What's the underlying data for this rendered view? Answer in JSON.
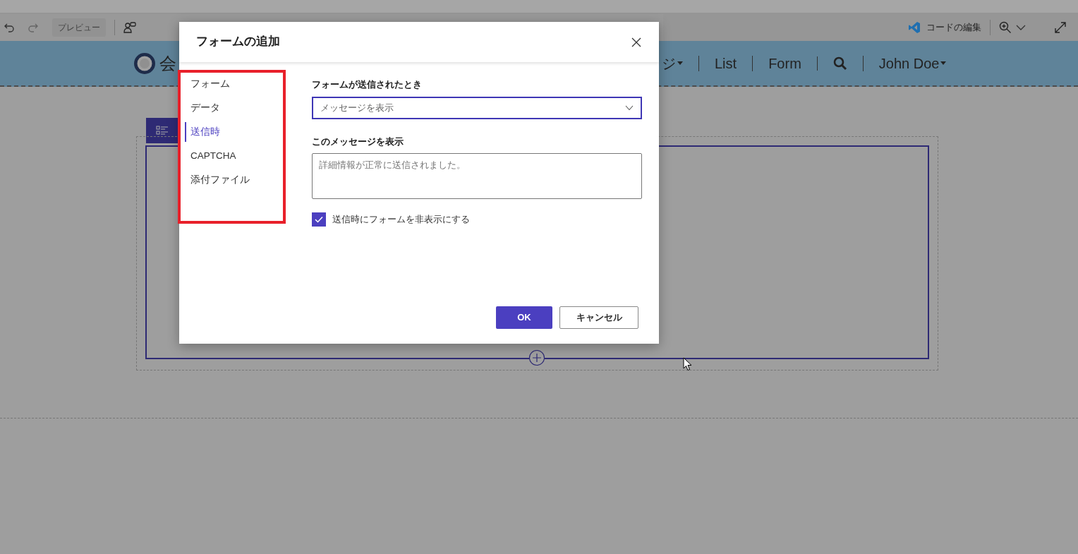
{
  "toolbar": {
    "preview_button": "プレビュー",
    "edit_code_button": "コードの編集"
  },
  "header": {
    "brand": "会",
    "nav_items": [
      {
        "kind": "link",
        "label": "ジ",
        "dropdown": true
      },
      {
        "kind": "link",
        "label": "List",
        "dropdown": false
      },
      {
        "kind": "link",
        "label": "Form",
        "dropdown": false
      },
      {
        "kind": "search"
      },
      {
        "kind": "link",
        "label": "John Doe",
        "dropdown": true
      }
    ]
  },
  "dialog": {
    "title": "フォームの追加",
    "sidebar": [
      {
        "label": "フォーム",
        "selected": false
      },
      {
        "label": "データ",
        "selected": false
      },
      {
        "label": "送信時",
        "selected": true
      },
      {
        "label": "CAPTCHA",
        "selected": false
      },
      {
        "label": "添付ファイル",
        "selected": false
      }
    ],
    "on_submit": {
      "label": "フォームが送信されたとき",
      "value": "メッセージを表示"
    },
    "message": {
      "label": "このメッセージを表示",
      "placeholder": "詳細情報が正常に送信されました。"
    },
    "hide_form": {
      "label": "送信時にフォームを非表示にする",
      "checked": true
    },
    "buttons": [
      {
        "label": "OK",
        "kind": "primary"
      },
      {
        "label": "キャンセル",
        "kind": "secondary"
      }
    ]
  }
}
